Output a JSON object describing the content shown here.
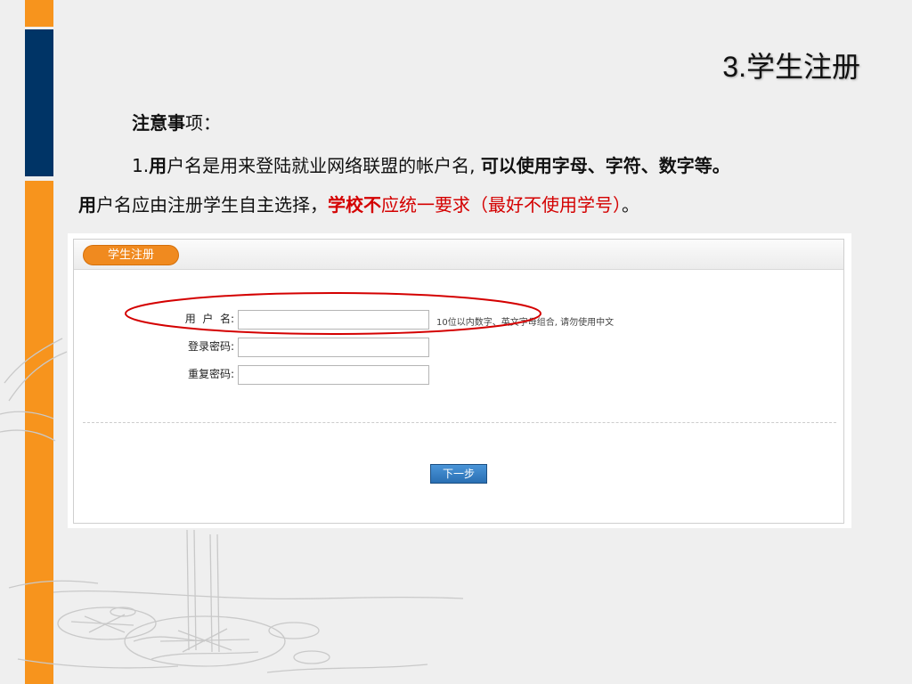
{
  "slide": {
    "title": "3.学生注册"
  },
  "notes": {
    "heading_bold": "注意事",
    "heading_rest": "项：",
    "line1_a": "1.",
    "line1_b": "用",
    "line1_c": "户名是用来登陆就业网络联盟的帐户名, ",
    "line1_d": "可以使用字母、字符、数字等。",
    "line2_a": "用",
    "line2_b": "户名应由注册学生自主选择，",
    "line2_c": "学校不",
    "line2_d": "应统一要求（最好不使用学号）",
    "line2_e": "。"
  },
  "form": {
    "header_tab": "学生注册",
    "username_label": "用  户  名:",
    "username_value": "",
    "username_hint": "10位以内数字、英文字母组合, 请勿使用中文",
    "password_label": "登录密码:",
    "password_value": "",
    "repeat_label": "重复密码:",
    "repeat_value": "",
    "next_button": "下一步"
  },
  "colors": {
    "accent_orange": "#f7941d",
    "accent_navy": "#003466",
    "highlight_red": "#d40000",
    "button_blue": "#2a6fb3"
  }
}
